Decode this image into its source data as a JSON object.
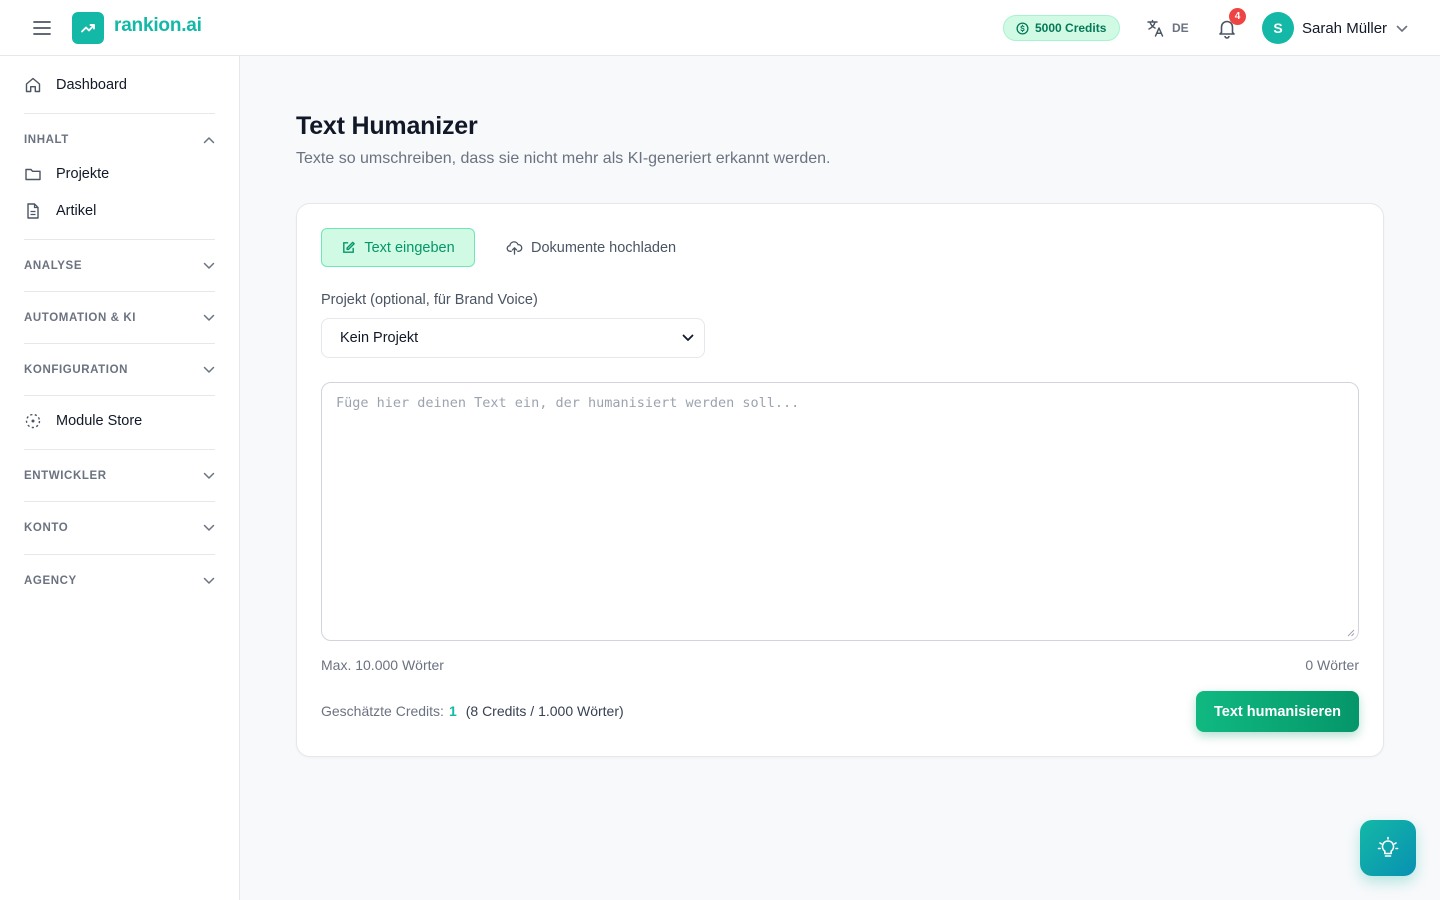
{
  "header": {
    "brand": "rankion.ai",
    "credits": "5000 Credits",
    "language": "DE",
    "notifications_count": "4",
    "user_initial": "S",
    "user_name": "Sarah Müller"
  },
  "sidebar": {
    "dashboard": "Dashboard",
    "sections": {
      "inhalt": "INHALT",
      "analyse": "ANALYSE",
      "automation": "AUTOMATION & KI",
      "konfiguration": "KONFIGURATION",
      "entwickler": "ENTWICKLER",
      "konto": "KONTO",
      "agency": "AGENCY"
    },
    "items": {
      "projekte": "Projekte",
      "artikel": "Artikel",
      "module_store": "Module Store"
    }
  },
  "main": {
    "title": "Text Humanizer",
    "subtitle": "Texte so umschreiben, dass sie nicht mehr als KI-generiert erkannt werden.",
    "tabs": {
      "text": "Text eingeben",
      "upload": "Dokumente hochladen"
    },
    "project_label": "Projekt (optional, für Brand Voice)",
    "project_value": "Kein Projekt",
    "textarea_placeholder": "Füge hier deinen Text ein, der humanisiert werden soll...",
    "max_words": "Max. 10.000 Wörter",
    "word_count": "0 Wörter",
    "est_label": "Geschätzte Credits:",
    "est_value": "1",
    "est_rate": "(8 Credits / 1.000 Wörter)",
    "submit": "Text humanisieren"
  },
  "colors": {
    "brand": "#14b8a6",
    "primary_button": "#059669",
    "badge": "#ef4444"
  }
}
